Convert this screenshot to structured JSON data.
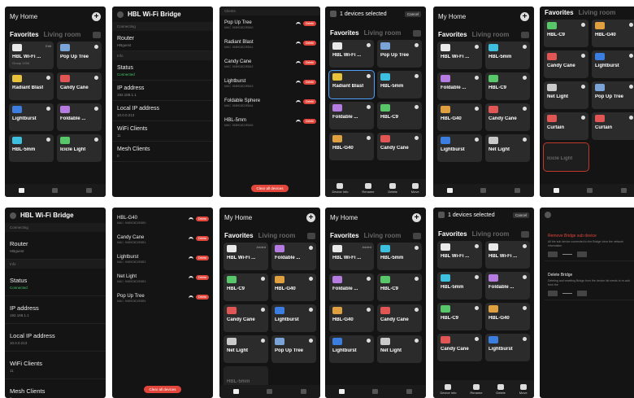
{
  "p1": {
    "title": "My Home",
    "tab_active": "Favorites",
    "tab_inactive": "Living room",
    "cards": [
      {
        "name": "HBL Wi-Fi ...",
        "sub": "Group 1234",
        "tag": "Edit",
        "icon_color": "#e9e9e9"
      },
      {
        "name": "Pop Up Tree",
        "sub": "",
        "tag": "",
        "icon_color": "#7aa4d8"
      },
      {
        "name": "Radiant Blast",
        "sub": "",
        "tag": "",
        "icon_color": "#e8c23a"
      },
      {
        "name": "Candy Cane",
        "sub": "",
        "tag": "",
        "icon_color": "#e25555"
      },
      {
        "name": "Lightburst",
        "sub": "",
        "tag": "",
        "icon_color": "#3c7de0"
      },
      {
        "name": "Foldable ...",
        "sub": "",
        "tag": "",
        "icon_color": "#b57be0"
      },
      {
        "name": "HBL-5mm",
        "sub": "",
        "tag": "",
        "icon_color": "#3dbfe0"
      },
      {
        "name": "Icicle Light",
        "sub": "",
        "tag": "",
        "icon_color": "#58c76a"
      }
    ]
  },
  "p2": {
    "title": "HBL Wi-Fi Bridge",
    "sections": [
      "Connecting",
      "Info"
    ],
    "rows": [
      {
        "k": "Router",
        "v": "HBguest"
      },
      {
        "k": "Status",
        "v": "Connected"
      },
      {
        "k": "IP address",
        "v": "192.168.1.1"
      },
      {
        "k": "Local IP address",
        "v": "10.0.0.213"
      },
      {
        "k": "WiFi Clients",
        "v": "11"
      },
      {
        "k": "Mesh Clients",
        "v": "0"
      }
    ]
  },
  "p3": {
    "section": "Clients",
    "items": [
      {
        "k": "Pop Up Tree",
        "m": "MAC: 94B9C8D2E8A0"
      },
      {
        "k": "Radiant Blast",
        "m": "MAC: 94B9C8D2E8A1"
      },
      {
        "k": "Candy Cane",
        "m": "MAC: 94B9C8D2E8A2"
      },
      {
        "k": "Lightburst",
        "m": "MAC: 94B9C8D2E8A3"
      },
      {
        "k": "Foldable Sphere",
        "m": "MAC: 94B9C8D2E8A4"
      },
      {
        "k": "HBL-5mm",
        "m": "MAC: 94B9C8D2E8A5"
      }
    ],
    "delete_label": "Delete",
    "clear_label": "Clear all devices"
  },
  "p4": {
    "header": "1 devices selected",
    "cancel": "Cancel",
    "tab_active": "Favorites",
    "tab_inactive": "Living room",
    "cards": [
      {
        "name": "HBL Wi-Fi ...",
        "icon_color": "#e9e9e9"
      },
      {
        "name": "Pop Up Tree",
        "icon_color": "#7aa4d8"
      },
      {
        "name": "Radiant Blast",
        "icon_color": "#e8c23a"
      },
      {
        "name": "HBL-5mm",
        "icon_color": "#3dbfe0"
      },
      {
        "name": "Foldable ...",
        "icon_color": "#b57be0"
      },
      {
        "name": "HBL-C9",
        "icon_color": "#58c76a"
      },
      {
        "name": "HBL-G40",
        "icon_color": "#e0a040"
      },
      {
        "name": "Candy Cane",
        "icon_color": "#e25555"
      }
    ],
    "actions": [
      "Device Info",
      "Rename",
      "Delete",
      "Move"
    ]
  },
  "p5": {
    "title": "My Home",
    "tab_active": "Favorites",
    "tab_inactive": "Living room",
    "cards": [
      {
        "name": "HBL Wi-Fi ...",
        "icon_color": "#e9e9e9"
      },
      {
        "name": "HBL-5mm",
        "icon_color": "#3dbfe0"
      },
      {
        "name": "Foldable ...",
        "icon_color": "#b57be0"
      },
      {
        "name": "HBL-C9",
        "icon_color": "#58c76a"
      },
      {
        "name": "HBL-G40",
        "icon_color": "#e0a040"
      },
      {
        "name": "Candy Cane",
        "icon_color": "#e25555"
      },
      {
        "name": "Lightburst",
        "icon_color": "#3c7de0"
      },
      {
        "name": "Net Light",
        "icon_color": "#c9c9c9"
      }
    ]
  },
  "p6": {
    "tab_active": "Favorites",
    "tab_inactive": "Living room",
    "cards": [
      {
        "name": "HBL-C9",
        "icon_color": "#58c76a"
      },
      {
        "name": "HBL-G40",
        "icon_color": "#e0a040"
      },
      {
        "name": "Candy Cane",
        "icon_color": "#e25555"
      },
      {
        "name": "Lightburst",
        "icon_color": "#3c7de0"
      },
      {
        "name": "Net Light",
        "icon_color": "#c9c9c9"
      },
      {
        "name": "Pop Up Tree",
        "icon_color": "#7aa4d8"
      },
      {
        "name": "Curtain",
        "icon_color": "#e25555"
      },
      {
        "name": "Curtain",
        "icon_color": "#e25555"
      }
    ],
    "ghost": "Icicle Light"
  },
  "p7": {
    "title": "HBL Wi-Fi Bridge",
    "sections": [
      "Connecting",
      "Info"
    ],
    "rows": [
      {
        "k": "Router",
        "v": "HBguest"
      },
      {
        "k": "Status",
        "v": "Connected"
      },
      {
        "k": "IP address",
        "v": "192.168.1.1"
      },
      {
        "k": "Local IP address",
        "v": "10.0.0.213"
      },
      {
        "k": "WiFi Clients",
        "v": "11"
      },
      {
        "k": "Mesh Clients",
        "v": "0"
      }
    ]
  },
  "p8": {
    "items": [
      {
        "k": "HBL-G40",
        "m": "MAC: 94B9C8D2E8B0"
      },
      {
        "k": "Candy Cane",
        "m": "MAC: 94B9C8D2E8B1"
      },
      {
        "k": "Lightburst",
        "m": "MAC: 94B9C8D2E8B2"
      },
      {
        "k": "Net Light",
        "m": "MAC: 94B9C8D2E8B3"
      },
      {
        "k": "Pop Up Tree",
        "m": "MAC: 94B9C8D2E8B4"
      }
    ],
    "delete_label": "Delete",
    "clear_label": "Clear all devices"
  },
  "p9": {
    "title": "My Home",
    "tab_active": "Favorites",
    "tab_inactive": "Living room",
    "cards": [
      {
        "name": "HBL Wi-Fi ...",
        "tag": "Added",
        "icon_color": "#e9e9e9"
      },
      {
        "name": "Foldable ...",
        "icon_color": "#b57be0"
      },
      {
        "name": "HBL-C9",
        "icon_color": "#58c76a"
      },
      {
        "name": "HBL-G40",
        "icon_color": "#e0a040"
      },
      {
        "name": "Candy Cane",
        "icon_color": "#e25555"
      },
      {
        "name": "Lightburst",
        "icon_color": "#3c7de0"
      },
      {
        "name": "Net Light",
        "icon_color": "#c9c9c9"
      },
      {
        "name": "Pop Up Tree",
        "icon_color": "#7aa4d8"
      }
    ],
    "ghost": "HBL-5mm"
  },
  "p10": {
    "title": "My Home",
    "tab_active": "Favorites",
    "tab_inactive": "Living room",
    "cards": [
      {
        "name": "HBL Wi-Fi ...",
        "tag": "Added",
        "icon_color": "#e9e9e9"
      },
      {
        "name": "HBL-5mm",
        "icon_color": "#3dbfe0"
      },
      {
        "name": "Foldable ...",
        "icon_color": "#b57be0"
      },
      {
        "name": "HBL-C9",
        "icon_color": "#58c76a"
      },
      {
        "name": "HBL-G40",
        "icon_color": "#e0a040"
      },
      {
        "name": "Candy Cane",
        "icon_color": "#e25555"
      },
      {
        "name": "Lightburst",
        "icon_color": "#3c7de0"
      },
      {
        "name": "Net Light",
        "icon_color": "#c9c9c9"
      }
    ]
  },
  "p11": {
    "header": "1 devices selected",
    "cancel": "Cancel",
    "tab_active": "Favorites",
    "tab_inactive": "Living room",
    "cards": [
      {
        "name": "HBL Wi-Fi ...",
        "icon_color": "#e9e9e9"
      },
      {
        "name": "HBL Wi-Fi ...",
        "icon_color": "#e9e9e9"
      },
      {
        "name": "HBL-5mm",
        "icon_color": "#3dbfe0"
      },
      {
        "name": "Foldable ...",
        "icon_color": "#b57be0"
      },
      {
        "name": "HBL-C9",
        "icon_color": "#58c76a"
      },
      {
        "name": "HBL-G40",
        "icon_color": "#e0a040"
      },
      {
        "name": "Candy Cane",
        "icon_color": "#e25555"
      },
      {
        "name": "Lightburst",
        "icon_color": "#3c7de0"
      }
    ],
    "actions": [
      "Device Info",
      "Rename",
      "Delete",
      "Move"
    ]
  },
  "p12": {
    "box1_title": "Remove Bridge sub device",
    "box1_desc": "All the sub device connected to the Bridge clear the network information",
    "box2_title": "Delete Bridge",
    "box2_desc": "Deleting and resetting Bridge from the device list needs to re-add from the"
  }
}
